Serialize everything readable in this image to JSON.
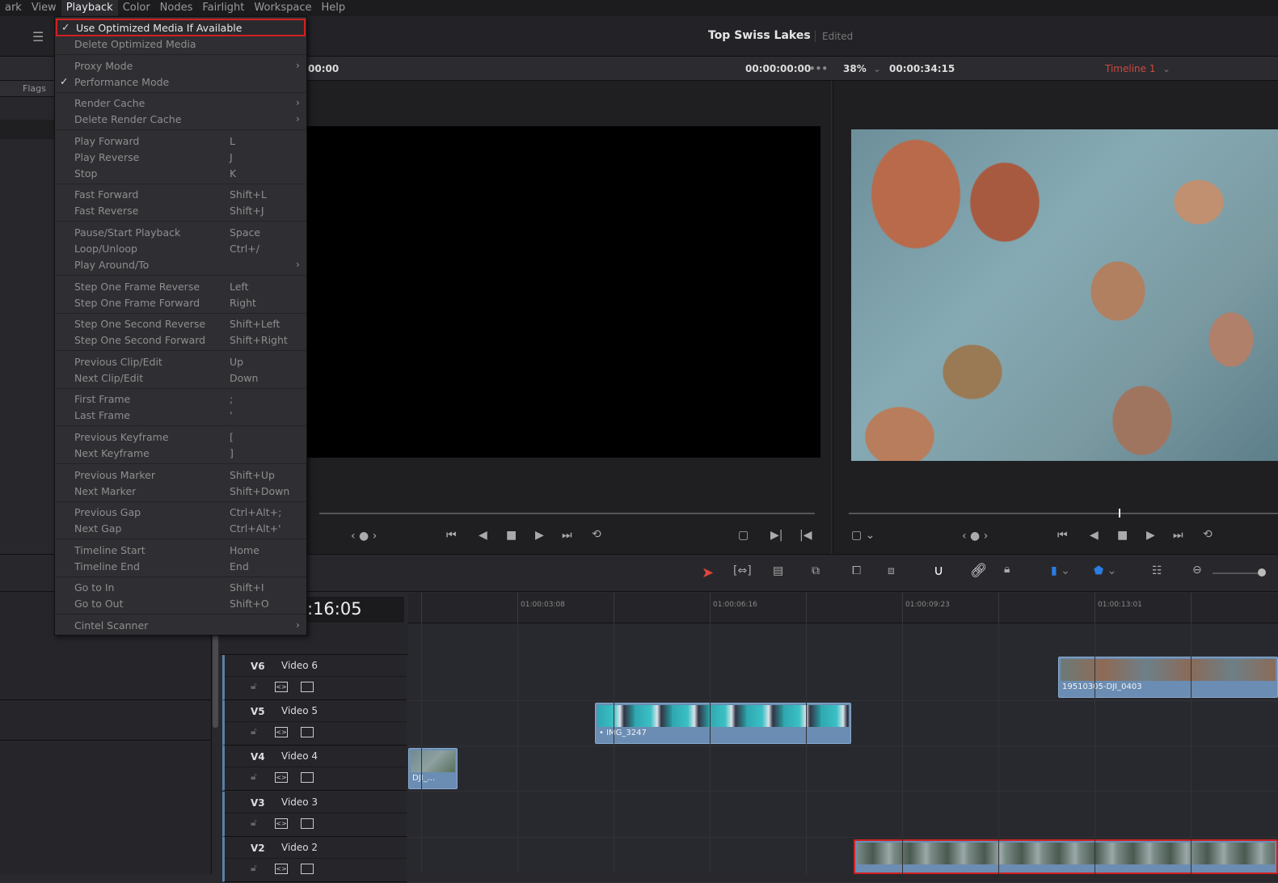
{
  "menubar": [
    "ark",
    "View",
    "Playback",
    "Color",
    "Nodes",
    "Fairlight",
    "Workspace",
    "Help"
  ],
  "active_menu": "Playback",
  "project": {
    "title": "Top Swiss Lakes",
    "status": "Edited"
  },
  "viewer": {
    "source_tc": "00:00",
    "timecode": "00:00:00:00",
    "zoom": "38%",
    "duration": "00:00:34:15",
    "timeline_name": "Timeline 1",
    "more": "•••"
  },
  "left": {
    "flags_label": "Flags"
  },
  "menu": [
    [
      {
        "label": "Use Optimized Media If Available",
        "checked": true,
        "enabled": true,
        "highlight": true
      },
      {
        "label": "Delete Optimized Media"
      }
    ],
    [
      {
        "label": "Proxy Mode",
        "submenu": true
      },
      {
        "label": "Performance Mode",
        "checked": true
      }
    ],
    [
      {
        "label": "Render Cache",
        "submenu": true
      },
      {
        "label": "Delete Render Cache",
        "submenu": true
      }
    ],
    [
      {
        "label": "Play Forward",
        "shortcut": "L"
      },
      {
        "label": "Play Reverse",
        "shortcut": "J"
      },
      {
        "label": "Stop",
        "shortcut": "K"
      }
    ],
    [
      {
        "label": "Fast Forward",
        "shortcut": "Shift+L"
      },
      {
        "label": "Fast Reverse",
        "shortcut": "Shift+J"
      }
    ],
    [
      {
        "label": "Pause/Start Playback",
        "shortcut": "Space"
      },
      {
        "label": "Loop/Unloop",
        "shortcut": "Ctrl+/"
      },
      {
        "label": "Play Around/To",
        "submenu": true
      }
    ],
    [
      {
        "label": "Step One Frame Reverse",
        "shortcut": "Left"
      },
      {
        "label": "Step One Frame Forward",
        "shortcut": "Right"
      }
    ],
    [
      {
        "label": "Step One Second Reverse",
        "shortcut": "Shift+Left"
      },
      {
        "label": "Step One Second Forward",
        "shortcut": "Shift+Right"
      }
    ],
    [
      {
        "label": "Previous Clip/Edit",
        "shortcut": "Up"
      },
      {
        "label": "Next Clip/Edit",
        "shortcut": "Down"
      }
    ],
    [
      {
        "label": "First Frame",
        "shortcut": ";"
      },
      {
        "label": "Last Frame",
        "shortcut": "'"
      }
    ],
    [
      {
        "label": "Previous Keyframe",
        "shortcut": "["
      },
      {
        "label": "Next Keyframe",
        "shortcut": "]"
      }
    ],
    [
      {
        "label": "Previous Marker",
        "shortcut": "Shift+Up"
      },
      {
        "label": "Next Marker",
        "shortcut": "Shift+Down"
      }
    ],
    [
      {
        "label": "Previous Gap",
        "shortcut": "Ctrl+Alt+;"
      },
      {
        "label": "Next Gap",
        "shortcut": "Ctrl+Alt+'"
      }
    ],
    [
      {
        "label": "Timeline Start",
        "shortcut": "Home"
      },
      {
        "label": "Timeline End",
        "shortcut": "End"
      }
    ],
    [
      {
        "label": "Go to In",
        "shortcut": "Shift+I"
      },
      {
        "label": "Go to Out",
        "shortcut": "Shift+O"
      }
    ],
    [
      {
        "label": "Cintel Scanner",
        "submenu": true
      }
    ]
  ],
  "timeline": {
    "timecode": ":16:05",
    "ruler": [
      "01:00:03:08",
      "01:00:06:16",
      "01:00:09:23",
      "01:00:13:01"
    ],
    "tracks": [
      {
        "id": "V6",
        "name": "Video 6"
      },
      {
        "id": "V5",
        "name": "Video 5"
      },
      {
        "id": "V4",
        "name": "Video 4"
      },
      {
        "id": "V3",
        "name": "Video 3"
      },
      {
        "id": "V2",
        "name": "Video 2"
      }
    ],
    "clips": [
      {
        "track": "V6",
        "name": "19510305-DJI_0403"
      },
      {
        "track": "V5",
        "name": "• IMG_3247"
      },
      {
        "track": "V4",
        "name": "DJI_..."
      },
      {
        "track": "V2",
        "name": ""
      }
    ]
  },
  "colors": {
    "accent_red": "#d12020",
    "clip_blue": "#6b8db3",
    "timeline_name": "#d0493f"
  }
}
